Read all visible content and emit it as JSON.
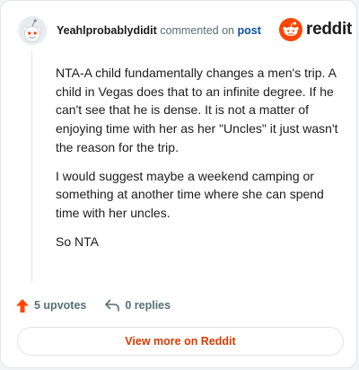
{
  "comment": {
    "author": "Yeahlprobablydidit",
    "meta_text": "commented on",
    "post_link": "post",
    "paragraphs": [
      "NTA-A child fundamentally changes a men's trip. A child in Vegas does that to an infinite degree. If he can't see that he is dense. It is not a matter of enjoying time with her as her \"Uncles\" it just wasn't the reason for the trip.",
      "I would suggest maybe a weekend camping or something at another time where she can spend time with her uncles.",
      "So NTA"
    ]
  },
  "brand": {
    "wordmark": "reddit",
    "color": "#ff4500"
  },
  "actions": {
    "upvotes": "5 upvotes",
    "replies": "0 replies"
  },
  "view_more": "View more on Reddit",
  "icons": {
    "avatar": "snoo-avatar-icon",
    "logo": "reddit-logo-icon",
    "upvote": "upvote-arrow-icon",
    "reply": "reply-arrow-icon"
  },
  "colors": {
    "upvote": "#ff4500",
    "link": "#0b4fa8",
    "view_more": "#d93a00",
    "muted": "#576f76"
  }
}
